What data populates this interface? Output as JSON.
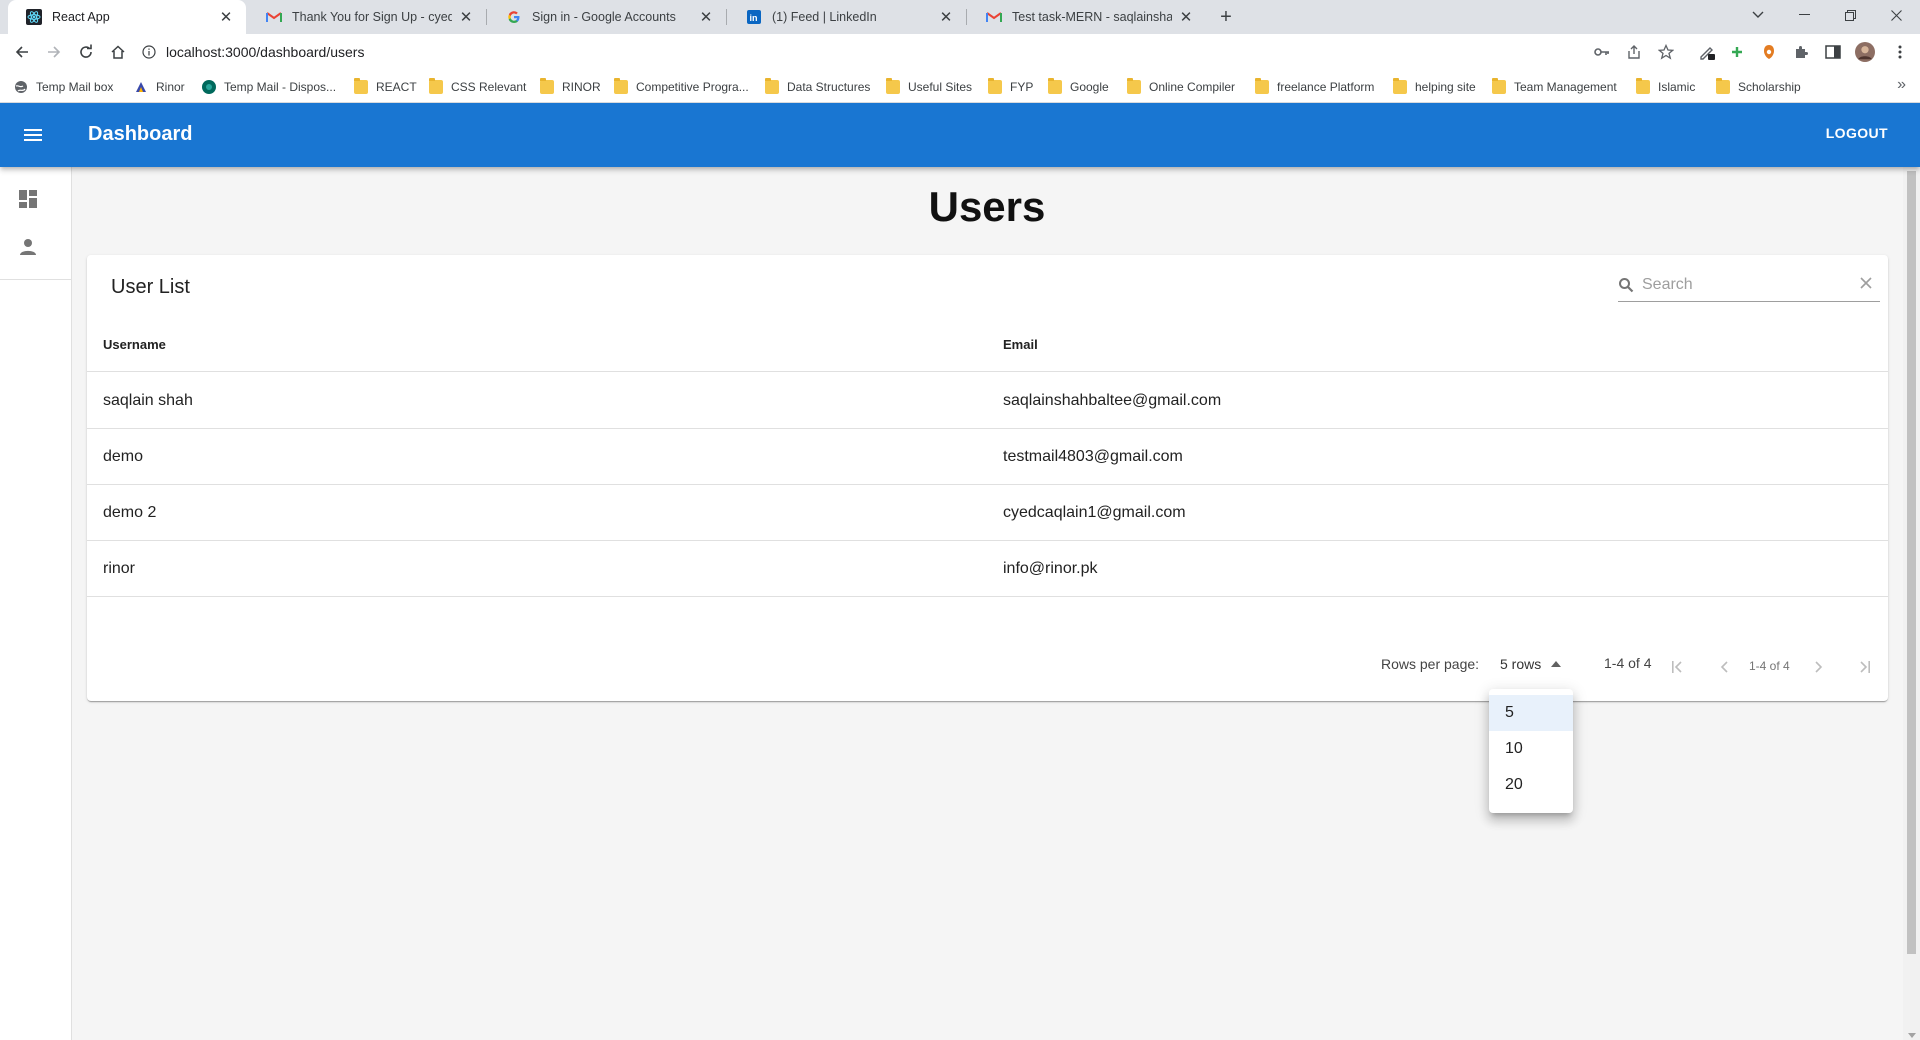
{
  "browser": {
    "tabs": [
      {
        "title": "React App",
        "icon": "react-icon",
        "active": true
      },
      {
        "title": "Thank You for Sign Up - cyedcaq",
        "icon": "gmail-icon"
      },
      {
        "title": "Sign in - Google Accounts",
        "icon": "google-icon"
      },
      {
        "title": "(1) Feed | LinkedIn",
        "icon": "linkedin-icon"
      },
      {
        "title": "Test task-MERN - saqlainshahbal",
        "icon": "gmail-icon"
      }
    ],
    "url": "localhost:3000/dashboard/users",
    "bookmarks": [
      {
        "label": "Temp Mail box",
        "icon": "globe-icon"
      },
      {
        "label": "Rinor",
        "icon": "rinor-icon"
      },
      {
        "label": "Temp Mail - Dispos...",
        "icon": "tempmail-icon"
      },
      {
        "label": "REACT",
        "icon": "folder-icon"
      },
      {
        "label": "CSS Relevant",
        "icon": "folder-icon"
      },
      {
        "label": "RINOR",
        "icon": "folder-icon"
      },
      {
        "label": "Competitive Progra...",
        "icon": "folder-icon"
      },
      {
        "label": "Data Structures",
        "icon": "folder-icon"
      },
      {
        "label": "Useful Sites",
        "icon": "folder-icon"
      },
      {
        "label": "FYP",
        "icon": "folder-icon"
      },
      {
        "label": "Google",
        "icon": "folder-icon"
      },
      {
        "label": "Online Compiler",
        "icon": "folder-icon"
      },
      {
        "label": "freelance Platform",
        "icon": "folder-icon"
      },
      {
        "label": "helping site",
        "icon": "folder-icon"
      },
      {
        "label": "Team Management",
        "icon": "folder-icon"
      },
      {
        "label": "Islamic",
        "icon": "folder-icon"
      },
      {
        "label": "Scholarship",
        "icon": "folder-icon"
      }
    ]
  },
  "appbar": {
    "title": "Dashboard",
    "logout_label": "LOGOUT",
    "color": "#1976d2"
  },
  "page": {
    "title": "Users"
  },
  "card": {
    "title": "User List",
    "search_placeholder": "Search",
    "columns": [
      "Username",
      "Email"
    ],
    "rows": [
      {
        "username": "saqlain shah",
        "email": "saqlainshahbaltee@gmail.com"
      },
      {
        "username": "demo",
        "email": "testmail4803@gmail.com"
      },
      {
        "username": "demo 2",
        "email": "cyedcaqlain1@gmail.com"
      },
      {
        "username": "rinor",
        "email": "info@rinor.pk"
      }
    ]
  },
  "pagination": {
    "rows_per_page_label": "Rows per page:",
    "rows_value": "5 rows",
    "range": "1-4 of 4",
    "range_small": "1-4 of 4",
    "options": [
      "5",
      "10",
      "20"
    ],
    "selected_option": "5"
  }
}
